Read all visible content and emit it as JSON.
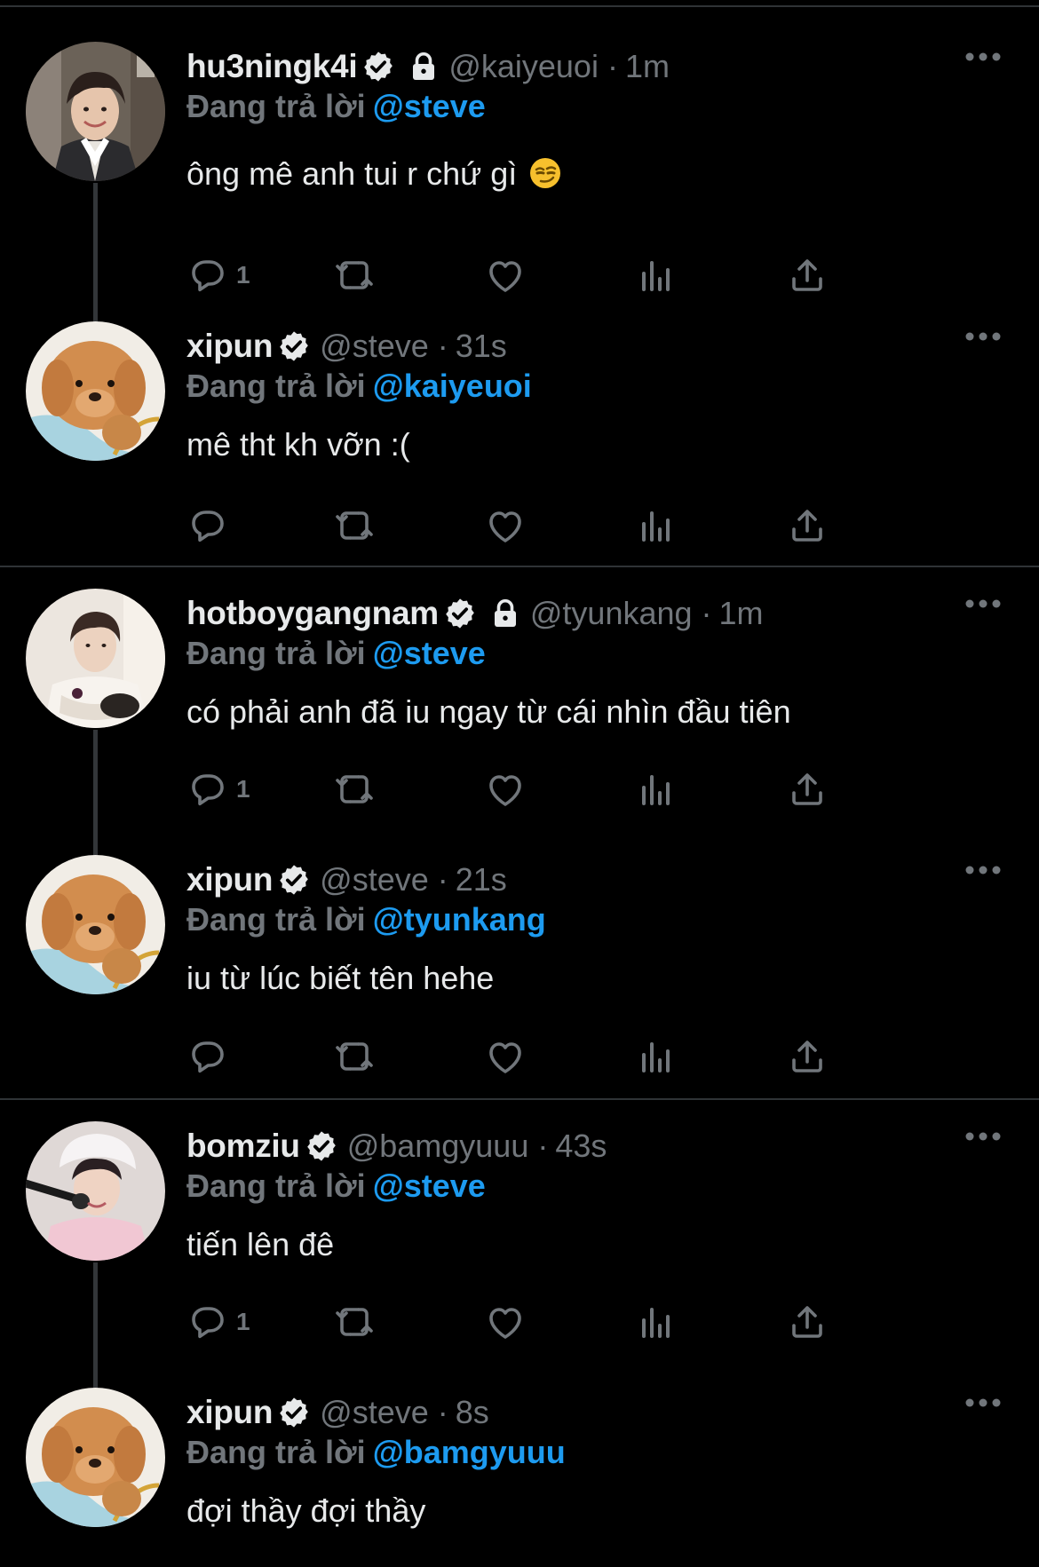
{
  "conversations": [
    {
      "parent": {
        "name": "hu3ningk4i",
        "verified": true,
        "locked": true,
        "handle": "@kaiyeuoi",
        "time": "1m",
        "reply_label": "Đang trả lời",
        "reply_to": "@steve",
        "text": "ông mê anh tui r chứ gì",
        "emoji": "smirking-face",
        "reply_count": "1",
        "avatar": "photo-boy-hanbok"
      },
      "reply": {
        "name": "xipun",
        "verified": true,
        "locked": false,
        "handle": "@steve",
        "time": "31s",
        "reply_label": "Đang trả lời",
        "reply_to": "@kaiyeuoi",
        "text": "mê tht kh vỡn :(",
        "reply_count": "",
        "avatar": "plush-puppy"
      }
    },
    {
      "parent": {
        "name": "hotboygangnam",
        "verified": true,
        "locked": true,
        "handle": "@tyunkang",
        "time": "1m",
        "reply_label": "Đang trả lời",
        "reply_to": "@steve",
        "text": "có phải anh đã iu ngay từ cái nhìn đầu tiên",
        "reply_count": "1",
        "avatar": "photo-boy-white-shirt"
      },
      "reply": {
        "name": "xipun",
        "verified": true,
        "locked": false,
        "handle": "@steve",
        "time": "21s",
        "reply_label": "Đang trả lời",
        "reply_to": "@tyunkang",
        "text": "iu từ lúc biết tên hehe",
        "reply_count": "",
        "avatar": "plush-puppy"
      }
    },
    {
      "parent": {
        "name": "bomziu",
        "verified": true,
        "locked": false,
        "handle": "@bamgyuuu",
        "time": "43s",
        "reply_label": "Đang trả lời",
        "reply_to": "@steve",
        "text": "tiến lên đê",
        "reply_count": "1",
        "avatar": "photo-boy-mic"
      },
      "reply": {
        "name": "xipun",
        "verified": true,
        "locked": false,
        "handle": "@steve",
        "time": "8s",
        "reply_label": "Đang trả lời",
        "reply_to": "@bamgyuuu",
        "text": "đợi thầy đợi thầy",
        "reply_count": "",
        "avatar": "plush-puppy"
      }
    }
  ],
  "action_icons": [
    "reply-icon",
    "retweet-icon",
    "like-icon",
    "views-icon",
    "share-icon"
  ],
  "colors": {
    "background": "#000000",
    "text": "#e7e9ea",
    "muted": "#71767b",
    "accent": "#1d9bf0",
    "divider": "#2f3336"
  }
}
